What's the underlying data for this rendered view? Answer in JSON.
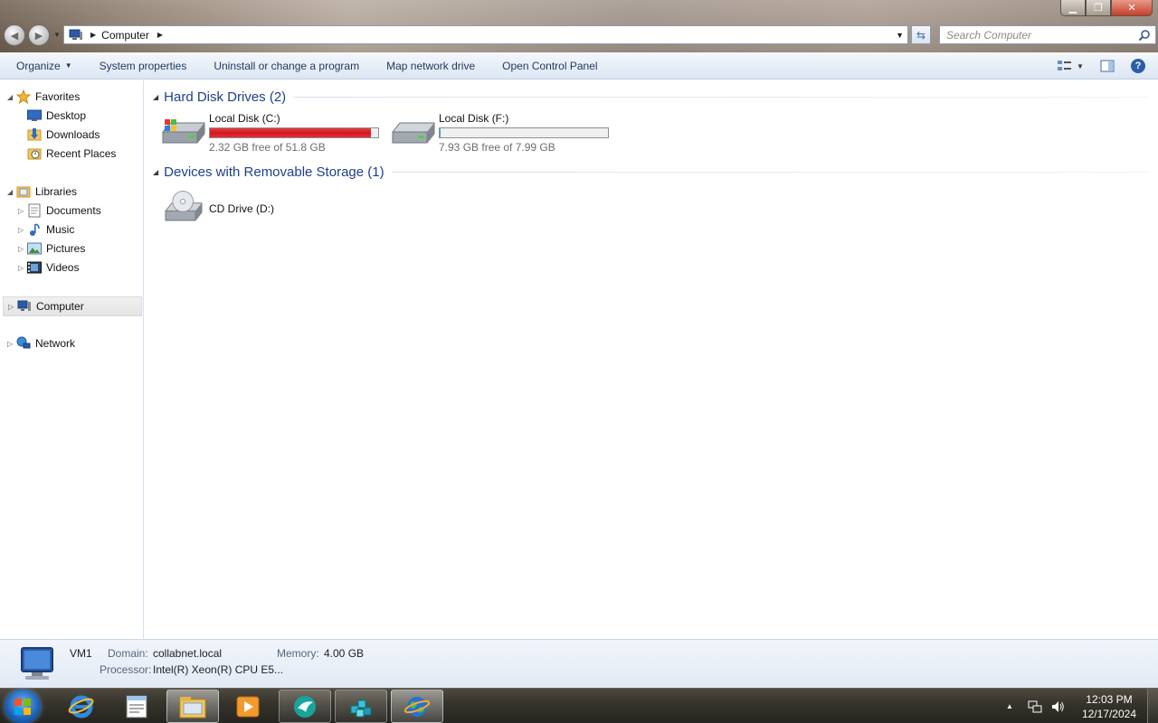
{
  "window": {
    "title_controls": [
      "minimize",
      "restore",
      "close"
    ],
    "close_glyph": "✕",
    "minimize_glyph": "▁",
    "restore_glyph": "❐"
  },
  "address_bar": {
    "crumbs": [
      "Computer"
    ],
    "icon": "computer-icon"
  },
  "search": {
    "placeholder": "Search Computer",
    "icon": "search-icon"
  },
  "command_bar": {
    "items": [
      {
        "label": "Organize",
        "has_dropdown": true
      },
      {
        "label": "System properties"
      },
      {
        "label": "Uninstall or change a program"
      },
      {
        "label": "Map network drive"
      },
      {
        "label": "Open Control Panel"
      }
    ],
    "right_icons": [
      "change-view-icon",
      "preview-pane-icon",
      "help-icon"
    ],
    "help_glyph": "?"
  },
  "sidebar": {
    "favorites": {
      "label": "Favorites",
      "items": [
        "Desktop",
        "Downloads",
        "Recent Places"
      ]
    },
    "libraries": {
      "label": "Libraries",
      "items": [
        "Documents",
        "Music",
        "Pictures",
        "Videos"
      ]
    },
    "computer": {
      "label": "Computer",
      "selected": true
    },
    "network": {
      "label": "Network"
    }
  },
  "content": {
    "groups": [
      {
        "title": "Hard Disk Drives (2)",
        "drives": [
          {
            "name": "Local Disk (C:)",
            "free_text": "2.32 GB free of 51.8 GB",
            "used_fraction": 0.955,
            "bar_color": "#d8151d"
          },
          {
            "name": "Local Disk (F:)",
            "free_text": "7.93 GB free of 7.99 GB",
            "used_fraction": 0.008,
            "bar_color": "#26a0da"
          }
        ]
      },
      {
        "title": "Devices with Removable Storage (1)",
        "drives": [
          {
            "name": "CD Drive (D:)"
          }
        ]
      }
    ]
  },
  "details": {
    "name": "VM1",
    "domain_label": "Domain:",
    "domain_value": "collabnet.local",
    "memory_label": "Memory:",
    "memory_value": "4.00 GB",
    "processor_label": "Processor:",
    "processor_value": "Intel(R) Xeon(R) CPU E5..."
  },
  "taskbar": {
    "items": [
      "internet-explorer-icon",
      "notepad-icon",
      "windows-explorer-icon",
      "media-player-icon",
      "app-bird-icon",
      "app-cubes-icon",
      "app-globe-icon"
    ],
    "clock_time": "12:03 PM",
    "clock_date": "12/17/2024",
    "tray_icons": [
      "show-hidden-icons-icon",
      "network-tray-icon",
      "volume-icon"
    ]
  },
  "colors": {
    "accent_blue": "#1e3f8a",
    "command_text": "#1e395b",
    "disk_full_red": "#d8151d",
    "disk_normal_blue": "#26a0da"
  }
}
